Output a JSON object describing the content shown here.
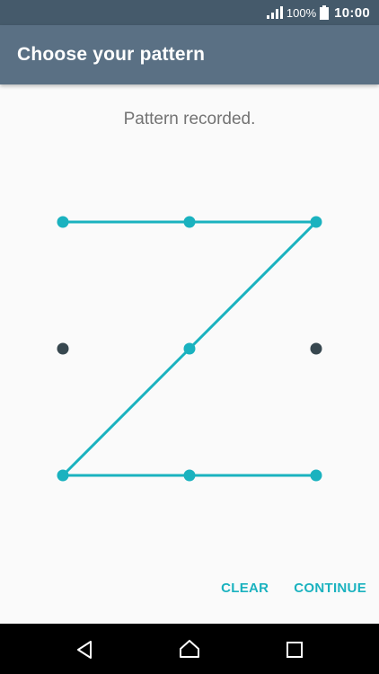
{
  "status_bar": {
    "battery_percent": "100%",
    "time": "10:00",
    "icons": [
      "signal-icon",
      "battery-icon"
    ]
  },
  "app_bar": {
    "title": "Choose your pattern"
  },
  "message": "Pattern recorded.",
  "pattern": {
    "grid": [
      3,
      3
    ],
    "selected_sequence": [
      1,
      2,
      3,
      5,
      7,
      8,
      9
    ],
    "unselected_dots": [
      4,
      6
    ],
    "colors": {
      "active": "#1ab2bf",
      "inactive": "#37474f"
    }
  },
  "actions": {
    "clear_label": "CLEAR",
    "continue_label": "CONTINUE"
  },
  "nav_bar": {
    "icons": [
      "back-icon",
      "home-icon",
      "recents-icon"
    ]
  },
  "colors": {
    "status_bar": "#455a6b",
    "app_bar": "#5a7084",
    "accent": "#1ab2bf",
    "background": "#fafafa"
  }
}
